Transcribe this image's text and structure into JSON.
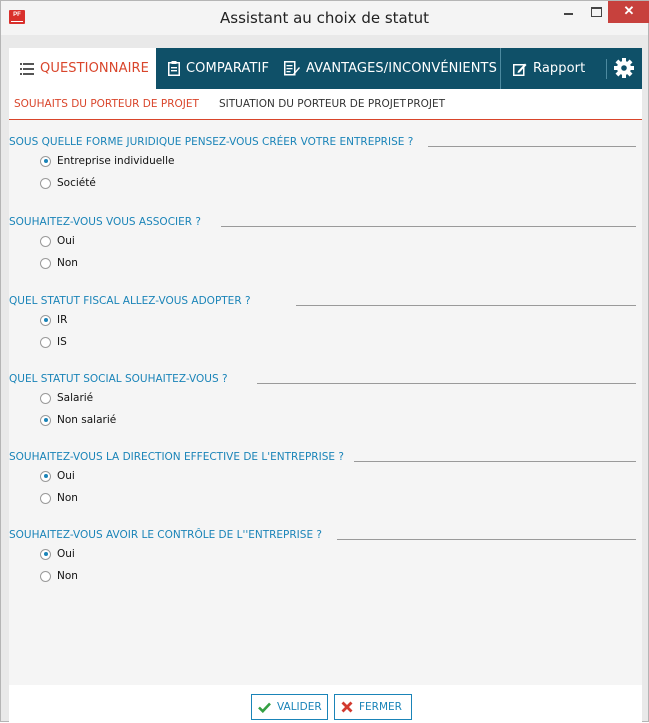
{
  "window": {
    "title": "Assistant au choix de statut",
    "app_icon_text": "PF"
  },
  "main_tabs": [
    {
      "label": "QUESTIONNAIRE",
      "icon": "list-icon",
      "active": true
    },
    {
      "label": "COMPARATIF",
      "icon": "clipboard-icon",
      "active": false
    },
    {
      "label": "AVANTAGES/INCONVÉNIENTS",
      "icon": "edit-document-icon",
      "active": false
    }
  ],
  "rapport": {
    "label": "Rapport",
    "icon": "edit-icon"
  },
  "settings": {
    "icon": "gear-icon"
  },
  "sub_tabs": [
    {
      "label": "SOUHAITS DU PORTEUR DE PROJET",
      "active": true
    },
    {
      "label": "SITUATION DU PORTEUR DE PROJET",
      "active": false
    },
    {
      "label": "PROJET",
      "active": false
    }
  ],
  "questions": [
    {
      "title": "SOUS QUELLE FORME JURIDIQUE PENSEZ-VOUS CRÉER VOTRE ENTREPRISE ?",
      "options": [
        "Entreprise individuelle",
        "Société"
      ],
      "selected": 0
    },
    {
      "title": "SOUHAITEZ-VOUS VOUS ASSOCIER ?",
      "options": [
        "Oui",
        "Non"
      ],
      "selected": -1
    },
    {
      "title": "QUEL STATUT FISCAL ALLEZ-VOUS ADOPTER ?",
      "options": [
        "IR",
        "IS"
      ],
      "selected": 0
    },
    {
      "title": "QUEL STATUT SOCIAL SOUHAITEZ-VOUS ?",
      "options": [
        "Salarié",
        "Non salarié"
      ],
      "selected": 1
    },
    {
      "title": "SOUHAITEZ-VOUS LA DIRECTION EFFECTIVE DE L'ENTREPRISE ?",
      "options": [
        "Oui",
        "Non"
      ],
      "selected": 0
    },
    {
      "title": "SOUHAITEZ-VOUS AVOIR LE CONTRÔLE DE L''ENTREPRISE ?",
      "options": [
        "Oui",
        "Non"
      ],
      "selected": 0
    }
  ],
  "footer": {
    "valider_label": "VALIDER",
    "fermer_label": "FERMER"
  },
  "colors": {
    "accent": "#d9452b",
    "primary_bar": "#0f5068",
    "link_blue": "#1a84b8",
    "close_button": "#c7413d"
  }
}
